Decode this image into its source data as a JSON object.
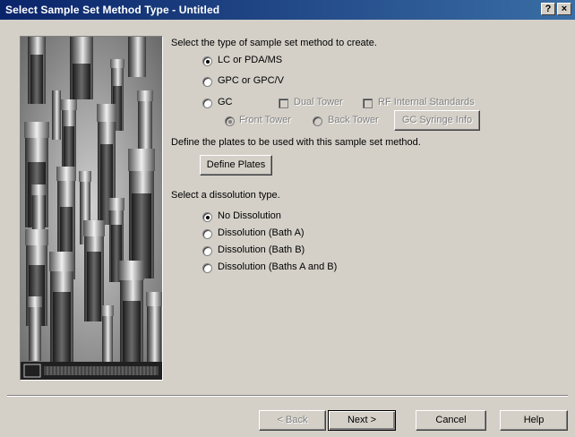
{
  "window": {
    "title": "Select Sample Set Method Type - Untitled",
    "help_btn": "?",
    "close_btn": "×"
  },
  "method_section": {
    "heading": "Select the type of sample set method to create.",
    "options": {
      "lc": "LC or PDA/MS",
      "gpc": "GPC or GPC/V",
      "gc": "GC"
    },
    "selected": "lc",
    "gc_options": {
      "dual_tower": "Dual Tower",
      "rf_internal": "RF Internal Standards",
      "front_tower": "Front Tower",
      "back_tower": "Back Tower",
      "syringe_btn": "GC Syringe Info"
    }
  },
  "plates_section": {
    "heading": "Define the plates to be used with this sample set method.",
    "define_btn": "Define Plates"
  },
  "dissolution_section": {
    "heading": "Select a dissolution type.",
    "options": {
      "none": "No Dissolution",
      "bath_a": "Dissolution (Bath A)",
      "bath_b": "Dissolution (Bath B)",
      "baths_ab": "Dissolution (Baths A and B)"
    },
    "selected": "none"
  },
  "footer": {
    "back": "< Back",
    "next": "Next >",
    "cancel": "Cancel",
    "help": "Help"
  }
}
